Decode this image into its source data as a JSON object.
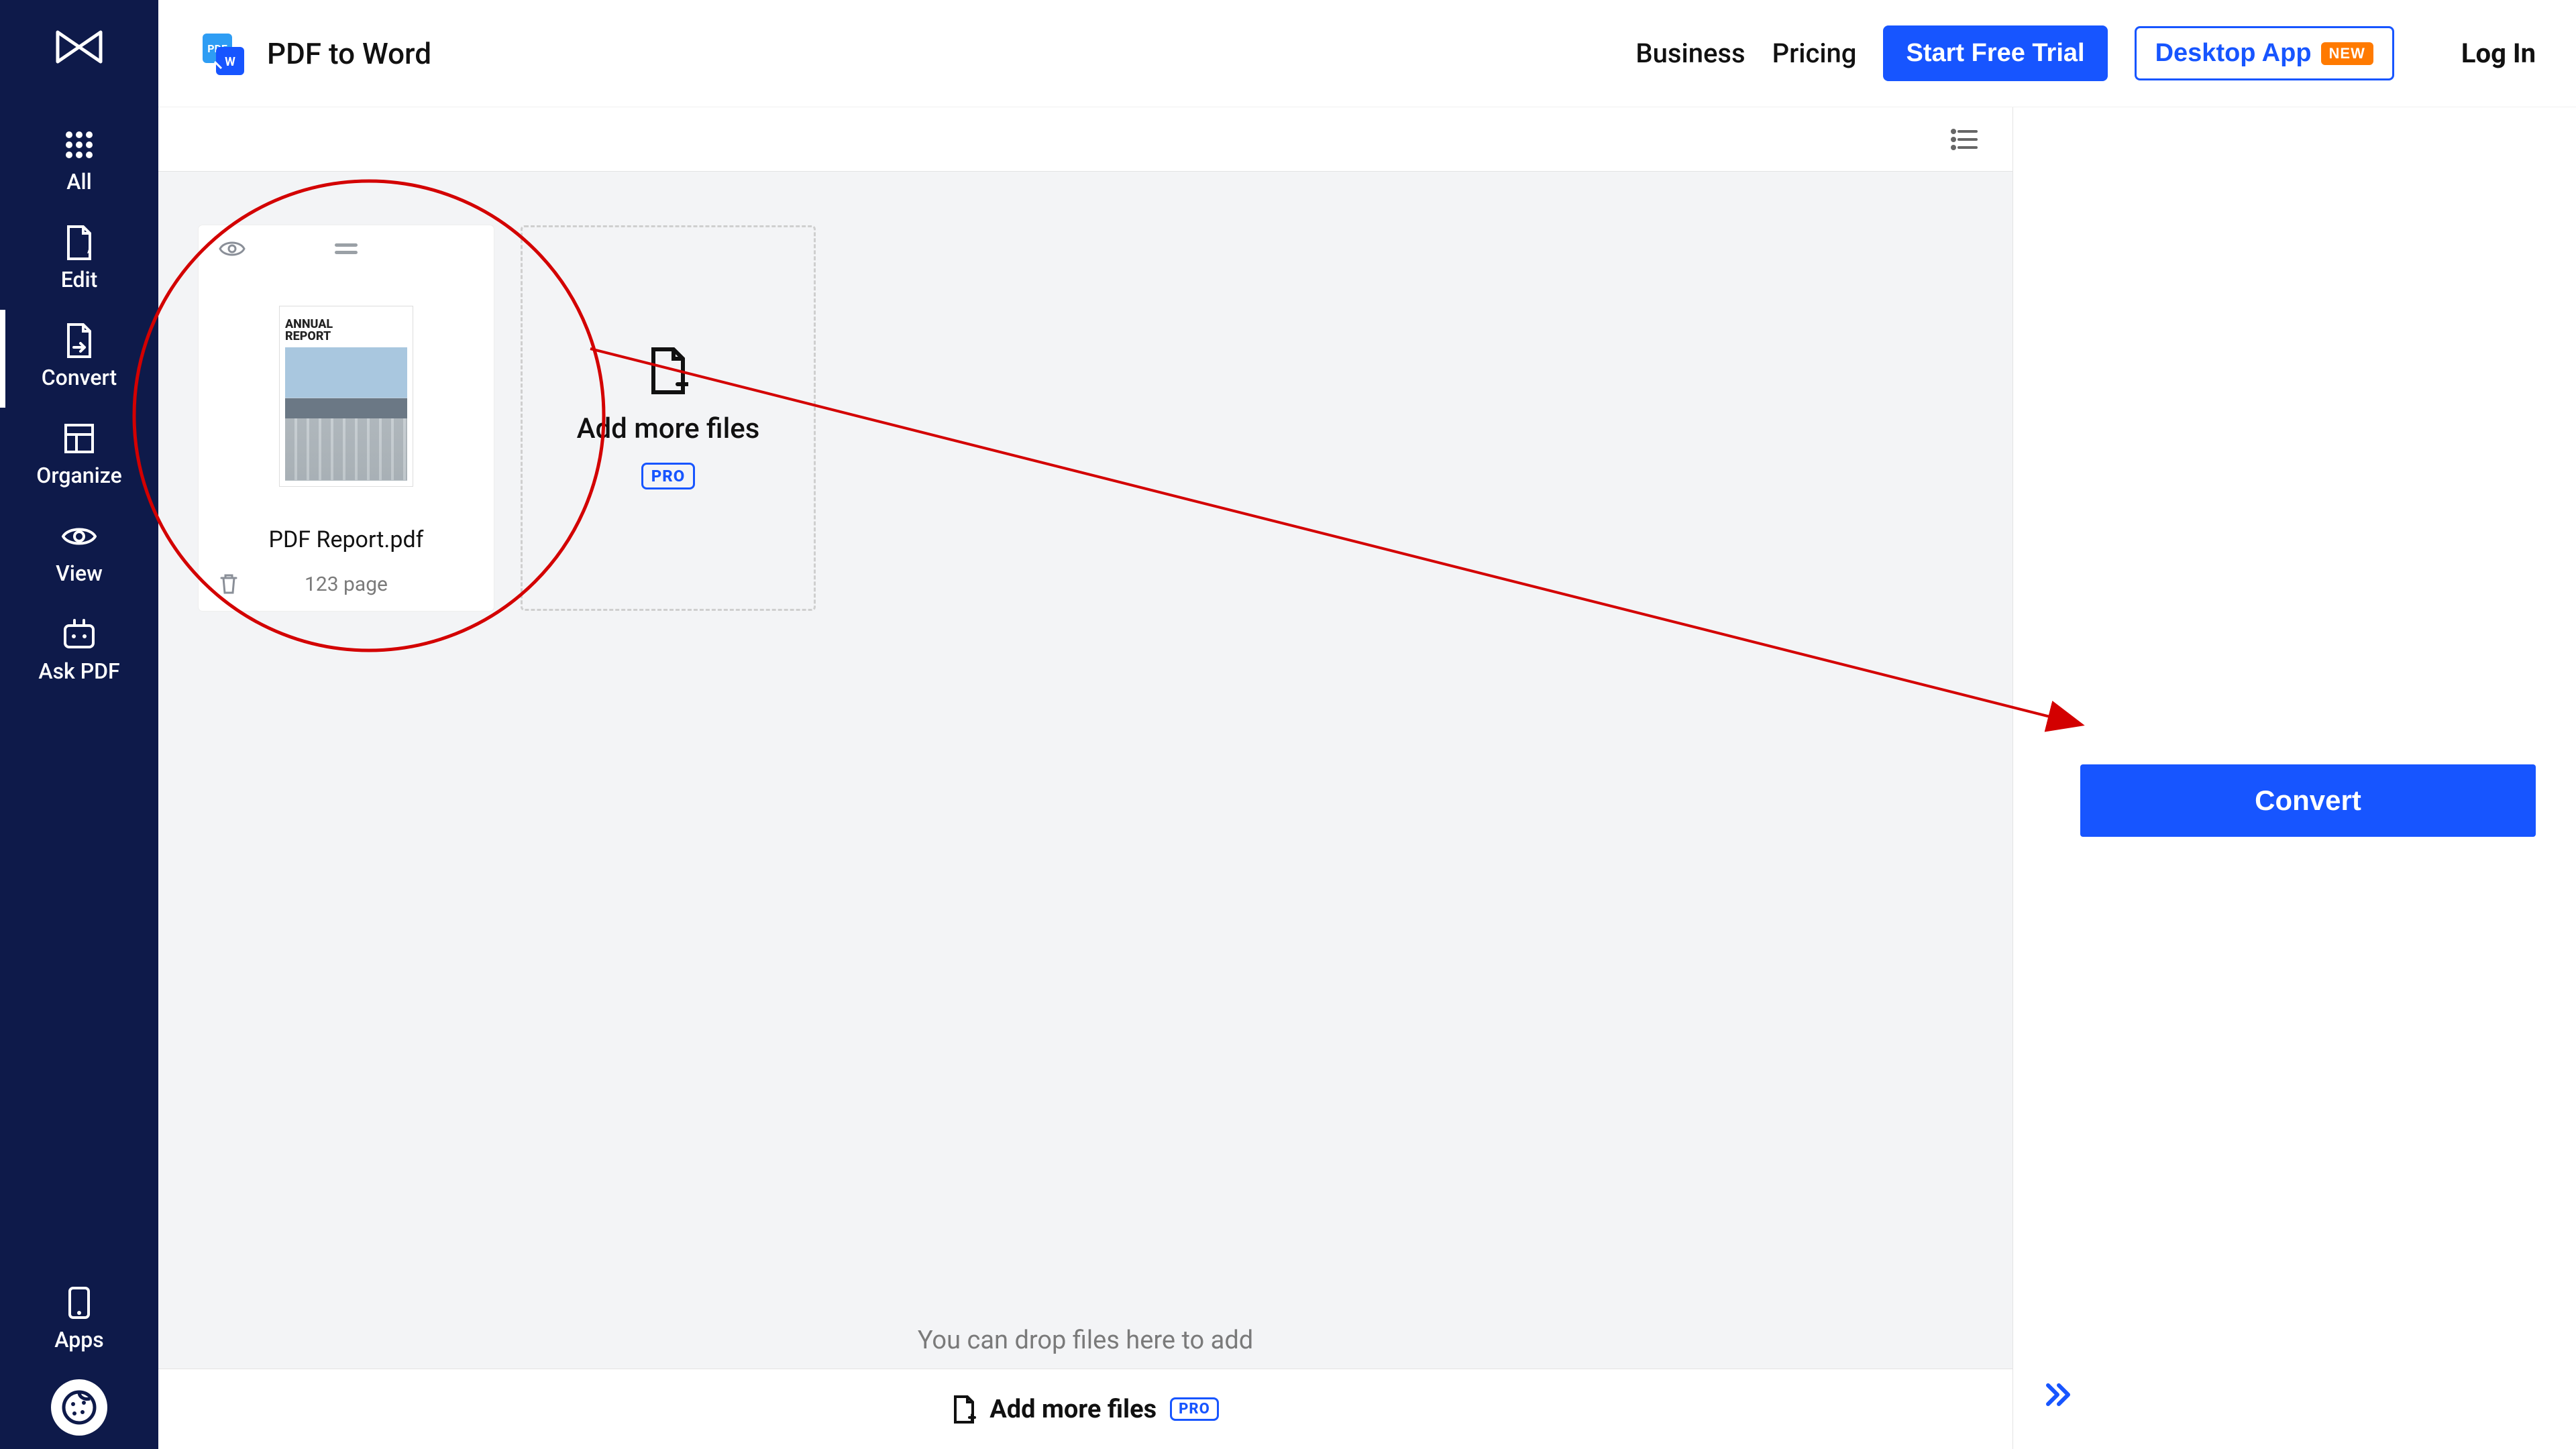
{
  "header": {
    "tool_title": "PDF to Word",
    "business": "Business",
    "pricing": "Pricing",
    "start_trial": "Start Free Trial",
    "desktop_app": "Desktop App",
    "new_badge": "NEW",
    "login": "Log In"
  },
  "sidebar": {
    "items": [
      {
        "label": "All"
      },
      {
        "label": "Edit"
      },
      {
        "label": "Convert"
      },
      {
        "label": "Organize"
      },
      {
        "label": "View"
      },
      {
        "label": "Ask PDF"
      }
    ],
    "apps": "Apps"
  },
  "workspace": {
    "file": {
      "name": "PDF Report.pdf",
      "page_count": "123 page",
      "thumb_title_line1": "ANNUAL",
      "thumb_title_line2": "REPORT"
    },
    "add_tile": {
      "label": "Add more files",
      "pro": "PRO"
    },
    "drop_hint": "You can drop files here to add",
    "bottom_add": {
      "label": "Add more files",
      "pro": "PRO"
    }
  },
  "right_panel": {
    "convert": "Convert"
  },
  "icons": {
    "list_view": "list-icon"
  }
}
